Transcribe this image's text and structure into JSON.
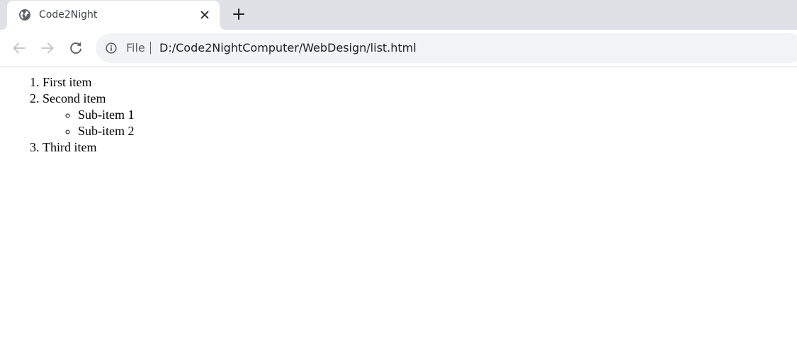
{
  "browser": {
    "tab": {
      "title": "Code2Night",
      "favicon": "globe-icon",
      "close_icon": "close-icon"
    },
    "new_tab_icon": "plus-icon",
    "toolbar": {
      "back_icon": "arrow-left-icon",
      "forward_icon": "arrow-right-icon",
      "reload_icon": "reload-icon"
    },
    "address_bar": {
      "info_icon": "info-icon",
      "scheme_label": "File",
      "url": "D:/Code2NightComputer/WebDesign/list.html"
    }
  },
  "page": {
    "list": {
      "items": [
        {
          "label": "First item"
        },
        {
          "label": "Second item",
          "sub_items": [
            "Sub-item 1",
            "Sub-item 2"
          ]
        },
        {
          "label": "Third item"
        }
      ]
    }
  },
  "colors": {
    "tabstrip_bg": "#dee1e6",
    "omnibox_bg": "#f1f3f4",
    "icon_gray": "#5f6368",
    "text_dark": "#202124"
  }
}
